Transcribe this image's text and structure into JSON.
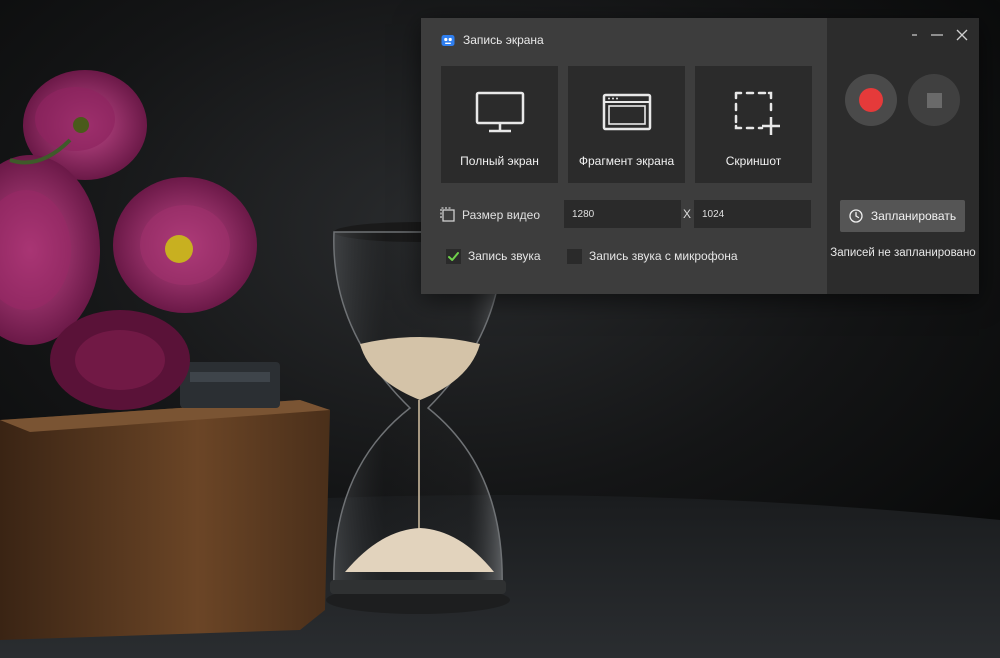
{
  "window": {
    "title": "Запись экрана"
  },
  "modes": [
    {
      "label": "Полный экран",
      "icon": "monitor-icon"
    },
    {
      "label": "Фрагмент экрана",
      "icon": "window-fragment-icon"
    },
    {
      "label": "Скриншот",
      "icon": "screenshot-select-icon"
    }
  ],
  "video_size": {
    "label": "Размер видео",
    "width": "1280",
    "height": "1024",
    "separator": "X"
  },
  "audio": {
    "system_label": "Запись звука",
    "system_checked": true,
    "mic_label": "Запись звука с микрофона",
    "mic_checked": false
  },
  "side": {
    "schedule_label": "Запланировать",
    "schedule_status": "Записей не запланировано"
  },
  "colors": {
    "record": "#e53a3a",
    "check": "#6fd14b",
    "panel": "#3d3d3d",
    "side_panel": "#2c2c2c"
  }
}
